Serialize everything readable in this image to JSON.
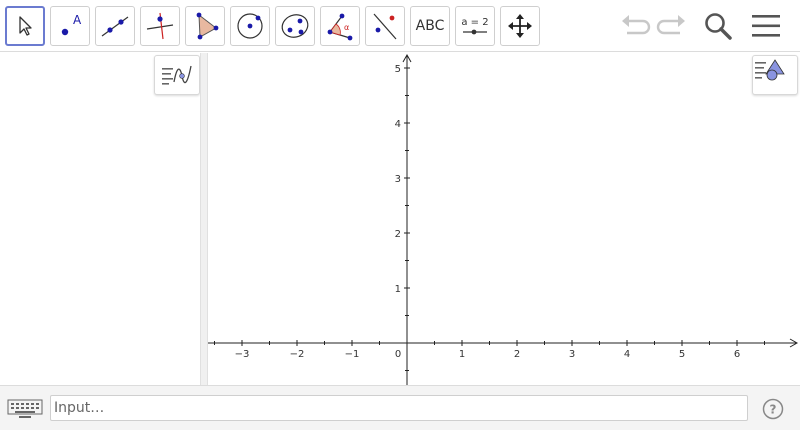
{
  "toolbar": {
    "tools": [
      {
        "name": "move",
        "icon": "cursor-arrow-icon"
      },
      {
        "name": "point",
        "icon": "point-icon",
        "label": "A"
      },
      {
        "name": "line",
        "icon": "line-icon"
      },
      {
        "name": "perpendicular",
        "icon": "perpendicular-line-icon"
      },
      {
        "name": "polygon",
        "icon": "polygon-icon"
      },
      {
        "name": "circle",
        "icon": "circle-center-point-icon"
      },
      {
        "name": "conic",
        "icon": "ellipse-icon"
      },
      {
        "name": "angle",
        "icon": "angle-icon",
        "label": "α"
      },
      {
        "name": "reflect",
        "icon": "reflect-line-icon"
      },
      {
        "name": "text",
        "icon": "text-icon",
        "label": "ABC"
      },
      {
        "name": "slider",
        "icon": "slider-icon",
        "label": "a = 2"
      },
      {
        "name": "move-graphics",
        "icon": "move-graphics-icon"
      }
    ],
    "undo_icon": "undo-icon",
    "redo_icon": "redo-icon",
    "search_icon": "search-icon",
    "menu_icon": "hamburger-menu-icon"
  },
  "algebra": {
    "style_button_icon": "algebra-style-bar-icon"
  },
  "graphics": {
    "style_button_icon": "graphics-style-bar-icon",
    "x_ticks": [
      "−3",
      "−2",
      "−1",
      "0",
      "1",
      "2",
      "3",
      "4",
      "5",
      "6"
    ],
    "y_ticks": [
      "1",
      "2",
      "3",
      "4",
      "5"
    ]
  },
  "input_bar": {
    "placeholder": "Input…",
    "keyboard_icon": "keyboard-icon",
    "help_icon": "help-icon"
  },
  "colors": {
    "accent": "#6b7bd0",
    "point_blue": "#1a1aa8",
    "polygon_fill": "#e8b8a0",
    "reflect_point": "#cc2222"
  }
}
